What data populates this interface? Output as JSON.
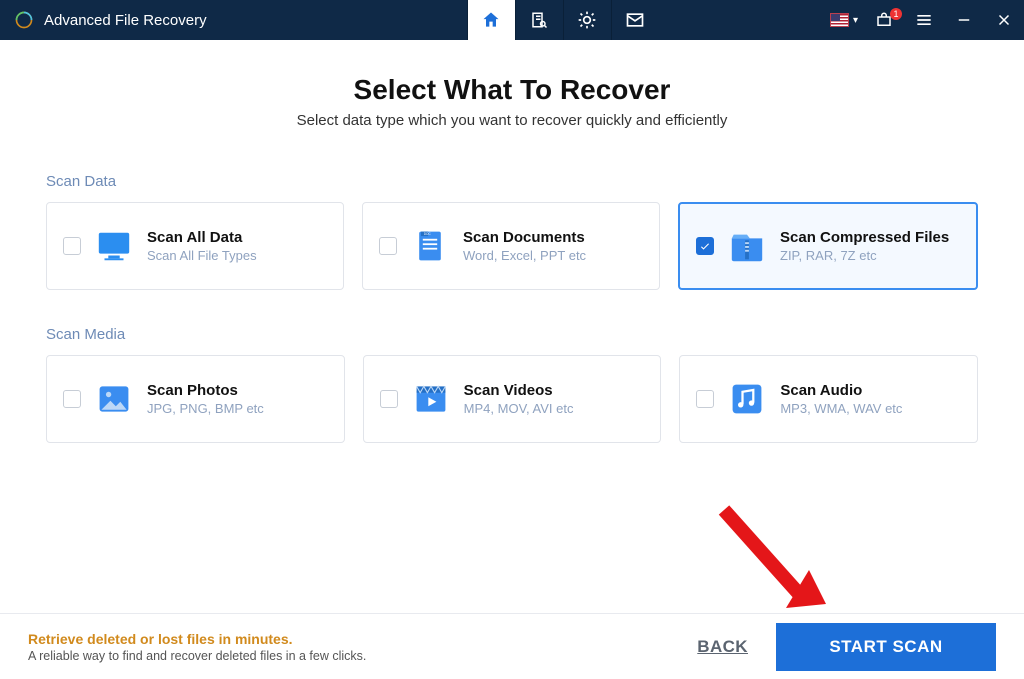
{
  "app": {
    "title": "Advanced File Recovery"
  },
  "header": {
    "title": "Select What To Recover",
    "subtitle": "Select data type which you want to recover quickly and efficiently"
  },
  "sections": {
    "data": {
      "label": "Scan Data",
      "items": [
        {
          "title": "Scan All Data",
          "desc": "Scan All File Types",
          "checked": false
        },
        {
          "title": "Scan Documents",
          "desc": "Word, Excel, PPT etc",
          "checked": false
        },
        {
          "title": "Scan Compressed Files",
          "desc": "ZIP, RAR, 7Z etc",
          "checked": true
        }
      ]
    },
    "media": {
      "label": "Scan Media",
      "items": [
        {
          "title": "Scan Photos",
          "desc": "JPG, PNG, BMP etc",
          "checked": false
        },
        {
          "title": "Scan Videos",
          "desc": "MP4, MOV, AVI etc",
          "checked": false
        },
        {
          "title": "Scan Audio",
          "desc": "MP3, WMA, WAV etc",
          "checked": false
        }
      ]
    }
  },
  "footer": {
    "promo_title": "Retrieve deleted or lost files in minutes.",
    "promo_desc": "A reliable way to find and recover deleted files in a few clicks.",
    "back": "BACK",
    "start": "START SCAN"
  },
  "topbar": {
    "notif_badge": "1"
  }
}
